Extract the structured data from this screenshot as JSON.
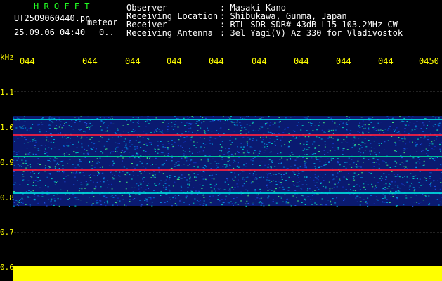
{
  "header": {
    "title": "H R O F F T",
    "filename": "UT2509060440.pn",
    "mode": "meteor",
    "datetime": "25.09.06 04:40",
    "counter": "0.."
  },
  "info": [
    {
      "label": "Observer",
      "value": ": Masaki Kano"
    },
    {
      "label": "Receiving Location",
      "value": ": Shibukawa, Gunma, Japan"
    },
    {
      "label": "Receiver",
      "value": ": RTL-SDR SDR# 43dB L15 103.2MHz CW"
    },
    {
      "label": "Receiving Antenna",
      "value": ": 3el Yagi(V) Az 330 for Vladivostok"
    }
  ],
  "axis": {
    "unit": "kHz",
    "y_ticks": [
      "1.1",
      "1.0",
      "0.9",
      "0.8",
      "0.7",
      "0.6"
    ],
    "x_ticks": [
      "044",
      "044",
      "044",
      "044",
      "044",
      "044",
      "044",
      "044",
      "044",
      "0450"
    ]
  },
  "colors": {
    "background": "#000000",
    "text_yellow": "#ffff00",
    "text_green": "#22ff22",
    "band_blue": "#1030a0",
    "signal_red": "#ff2040",
    "signal_cyan": "#00e0e0"
  }
}
